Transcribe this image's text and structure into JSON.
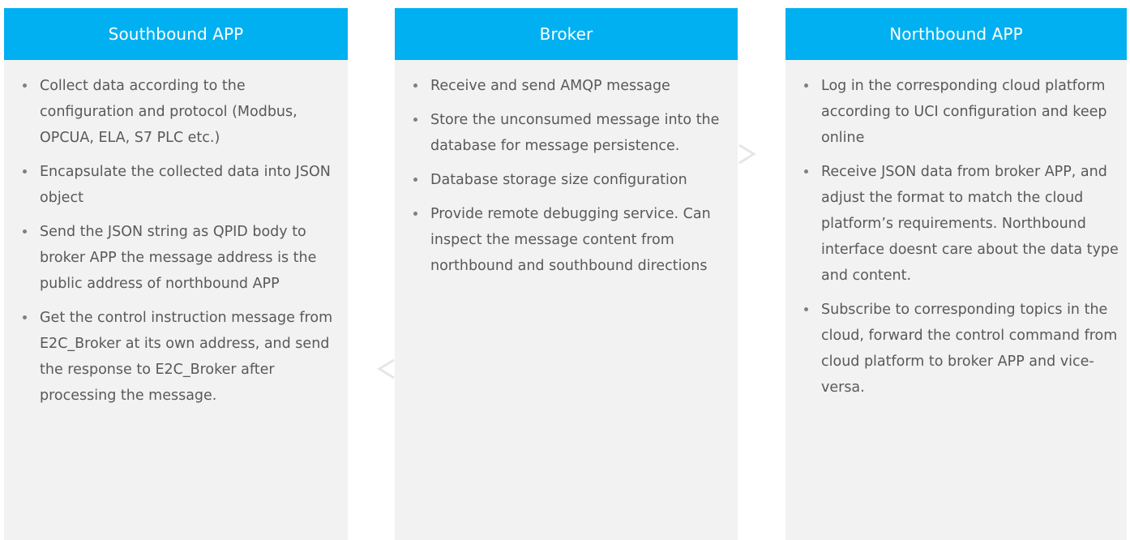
{
  "columns": [
    {
      "title": "Southbound APP",
      "bullets": [
        "Collect data according to the configuration and protocol (Modbus, OPCUA, ELA, S7 PLC etc.)",
        "Encapsulate the collected data into JSON object",
        "Send the JSON string as QPID body to broker APP the message address is the public address of northbound APP",
        "Get the control instruction message from E2C_Broker at its own address, and send the response to E2C_Broker after processing the message."
      ]
    },
    {
      "title": "Broker",
      "bullets": [
        "Receive and send AMQP message",
        "Store the unconsumed message into the database for message persistence.",
        "Database storage size configuration",
        "Provide remote debugging service. Can inspect the message content from northbound and southbound directions"
      ]
    },
    {
      "title": "Northbound APP",
      "bullets": [
        "Log in the corresponding cloud platform according to UCI configuration and keep online",
        "Receive JSON data from broker APP, and adjust the format to match the cloud platform’s requirements. Northbound interface doesnt care about the data type and content.",
        "Subscribe to corresponding topics in the cloud, forward the control command from cloud platform to broker APP and vice-versa."
      ]
    }
  ],
  "colors": {
    "header_bg": "#00b0f0",
    "header_text": "#ffffff",
    "panel_bg": "#f2f2f2",
    "body_text": "#595959"
  }
}
